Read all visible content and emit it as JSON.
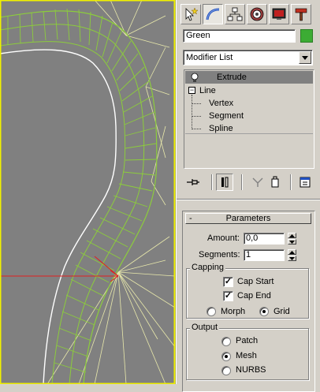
{
  "command_panel": {
    "tabs": [
      {
        "name": "create-tab",
        "icon": "pointer-star-icon"
      },
      {
        "name": "modify-tab",
        "icon": "modify-curve-icon"
      },
      {
        "name": "hierarchy-tab",
        "icon": "hierarchy-icon"
      },
      {
        "name": "motion-tab",
        "icon": "motion-icon"
      },
      {
        "name": "display-tab",
        "icon": "display-monitor-icon"
      },
      {
        "name": "utilities-tab",
        "icon": "hammer-icon"
      }
    ],
    "active_tab": "modify-tab",
    "object_name": "Green",
    "object_color": "#3cac34",
    "modifier_list": {
      "selected": "Modifier List"
    },
    "stack": {
      "items": [
        {
          "label": "Extrude",
          "selected": true
        },
        {
          "label": "Line",
          "expanded": true
        },
        {
          "label": "Vertex"
        },
        {
          "label": "Segment"
        },
        {
          "label": "Spline"
        }
      ]
    },
    "parameters": {
      "title": "Parameters",
      "collapse_symbol": "-",
      "amount_label": "Amount:",
      "amount_value": "0,0",
      "segments_label": "Segments:",
      "segments_value": "1",
      "capping": {
        "title": "Capping",
        "cap_start_label": "Cap Start",
        "cap_start_checked": true,
        "cap_end_label": "Cap End",
        "cap_end_checked": true,
        "morph_label": "Morph",
        "grid_label": "Grid",
        "selected": "Grid"
      },
      "output": {
        "title": "Output",
        "patch_label": "Patch",
        "mesh_label": "Mesh",
        "nurbs_label": "NURBS",
        "selected": "Mesh"
      }
    }
  },
  "viewport": {
    "background": "#808080",
    "mesh_color": "#8ccc3c",
    "border_color": "#f0f000",
    "outline_color": "#ffffff"
  }
}
